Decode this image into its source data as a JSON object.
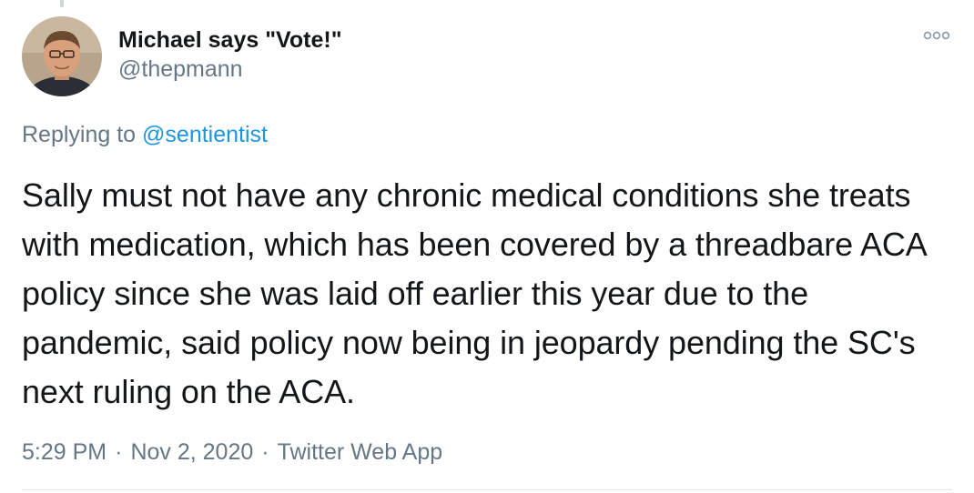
{
  "author": {
    "display_name": "Michael says \"Vote!\"",
    "handle": "@thepmann",
    "avatar_icon": "profile-photo"
  },
  "reply": {
    "prefix": "Replying to ",
    "mention": "@sentientist"
  },
  "tweet": {
    "text": "Sally must not have any chronic medical conditions she treats with medication, which has been covered by a threadbare ACA policy since she was laid off earlier this year due to the pandemic, said policy now being in jeopardy pending the SC's next ruling on the ACA."
  },
  "meta": {
    "time": "5:29 PM",
    "separator": "·",
    "date": "Nov 2, 2020",
    "source": "Twitter Web App"
  },
  "colors": {
    "text": "#14171a",
    "secondary": "#657786",
    "link": "#1b95e0",
    "divider": "#e1e8ed"
  },
  "icons": {
    "more": "more-horizontal-icon"
  }
}
